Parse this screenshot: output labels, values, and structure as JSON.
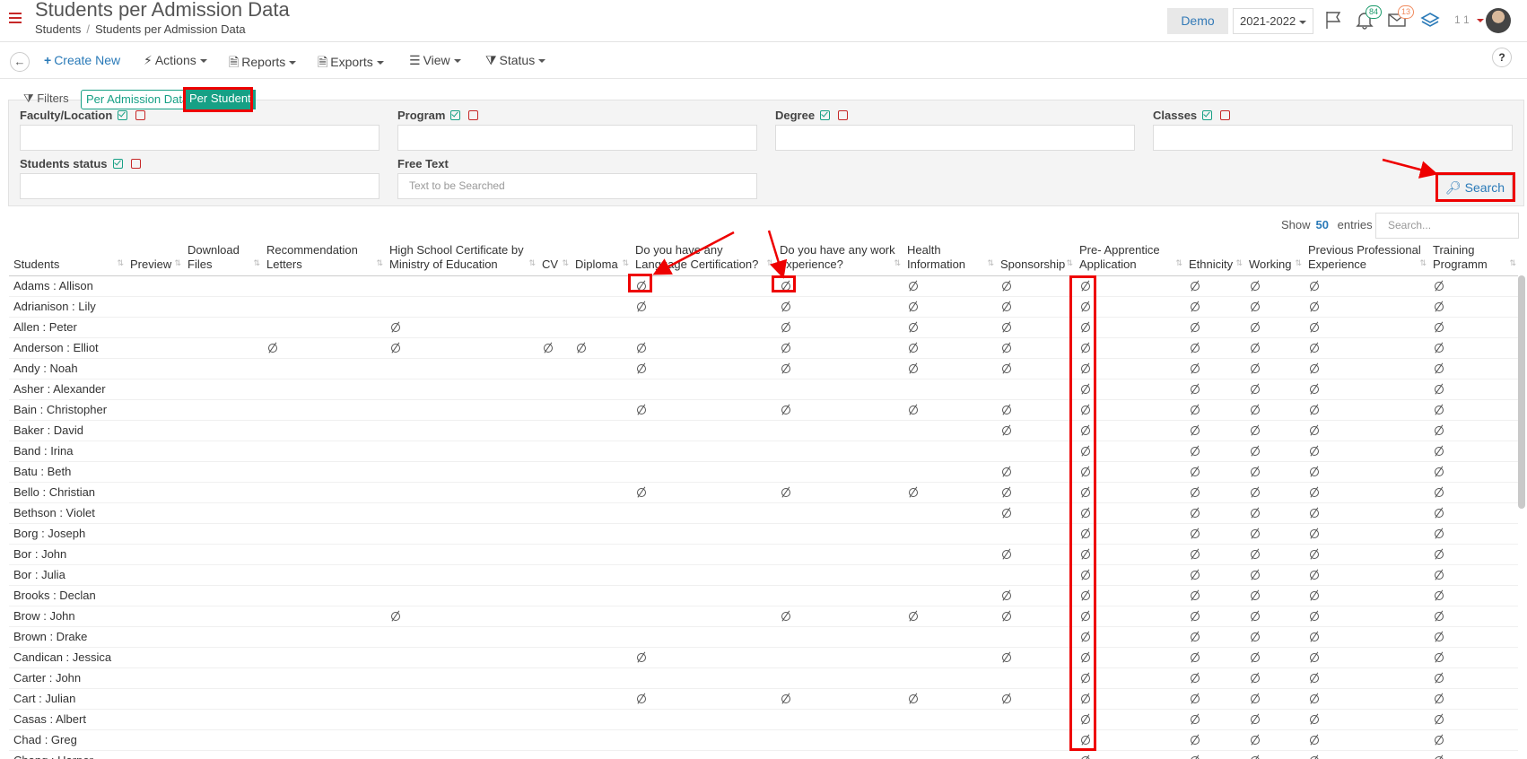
{
  "header": {
    "title": "Students per Admission Data",
    "breadcrumb": [
      "Students",
      "Students per Admission Data"
    ],
    "demo_label": "Demo",
    "year": "2021-2022",
    "notifications_count": "84",
    "messages_count": "13",
    "user_label": "1 1"
  },
  "toolbar": {
    "create": "Create New",
    "actions": "Actions",
    "reports": "Reports",
    "exports": "Exports",
    "view": "View",
    "status": "Status",
    "help": "?"
  },
  "filters": {
    "label": "Filters",
    "tab_admission": "Per Admission Data",
    "tab_student": "Per Student",
    "faculty": "Faculty/Location",
    "program": "Program",
    "degree": "Degree",
    "classes": "Classes",
    "students_status": "Students status",
    "free_text": "Free Text",
    "free_text_placeholder": "Text to be Searched",
    "search_button": "Search"
  },
  "table_controls": {
    "show": "Show",
    "count": "50",
    "entries": "entries",
    "search_placeholder": "Search..."
  },
  "columns": [
    "Students",
    "Preview",
    "Download Files",
    "Recommendation Letters",
    "High School Certificate by Ministry of Education",
    "CV",
    "Diploma",
    "Do you have any Language Certification?",
    "Do you have any work experience?",
    "Health Information",
    "Sponsorship",
    "Pre- Apprentice Application",
    "Ethnicity",
    "Working",
    "Previous Professional Experience",
    "Training Programm"
  ],
  "rows": [
    {
      "name": "Adams : Allison",
      "flags": [
        0,
        0,
        0,
        0,
        0,
        0,
        1,
        1,
        1,
        1,
        1,
        1,
        1,
        1,
        1
      ]
    },
    {
      "name": "Adrianison : Lily",
      "flags": [
        0,
        0,
        0,
        0,
        0,
        0,
        1,
        1,
        1,
        1,
        1,
        1,
        1,
        1,
        1
      ]
    },
    {
      "name": "Allen : Peter",
      "flags": [
        0,
        0,
        0,
        1,
        0,
        0,
        0,
        1,
        1,
        1,
        1,
        1,
        1,
        1,
        1
      ]
    },
    {
      "name": "Anderson : Elliot",
      "flags": [
        0,
        0,
        1,
        1,
        1,
        1,
        1,
        1,
        1,
        1,
        1,
        1,
        1,
        1,
        1
      ]
    },
    {
      "name": "Andy : Noah",
      "flags": [
        0,
        0,
        0,
        0,
        0,
        0,
        1,
        1,
        1,
        1,
        1,
        1,
        1,
        1,
        1
      ]
    },
    {
      "name": "Asher : Alexander",
      "flags": [
        0,
        0,
        0,
        0,
        0,
        0,
        0,
        0,
        0,
        0,
        1,
        1,
        1,
        1,
        1
      ]
    },
    {
      "name": "Bain : Christopher",
      "flags": [
        0,
        0,
        0,
        0,
        0,
        0,
        1,
        1,
        1,
        1,
        1,
        1,
        1,
        1,
        1
      ]
    },
    {
      "name": "Baker : David",
      "flags": [
        0,
        0,
        0,
        0,
        0,
        0,
        0,
        0,
        0,
        1,
        1,
        1,
        1,
        1,
        1
      ]
    },
    {
      "name": "Band : Irina",
      "flags": [
        0,
        0,
        0,
        0,
        0,
        0,
        0,
        0,
        0,
        0,
        1,
        1,
        1,
        1,
        1
      ]
    },
    {
      "name": "Batu : Beth",
      "flags": [
        0,
        0,
        0,
        0,
        0,
        0,
        0,
        0,
        0,
        1,
        1,
        1,
        1,
        1,
        1
      ]
    },
    {
      "name": "Bello : Christian",
      "flags": [
        0,
        0,
        0,
        0,
        0,
        0,
        1,
        1,
        1,
        1,
        1,
        1,
        1,
        1,
        1
      ]
    },
    {
      "name": "Bethson : Violet",
      "flags": [
        0,
        0,
        0,
        0,
        0,
        0,
        0,
        0,
        0,
        1,
        1,
        1,
        1,
        1,
        1
      ]
    },
    {
      "name": "Borg : Joseph",
      "flags": [
        0,
        0,
        0,
        0,
        0,
        0,
        0,
        0,
        0,
        0,
        1,
        1,
        1,
        1,
        1
      ]
    },
    {
      "name": "Bor : John",
      "flags": [
        0,
        0,
        0,
        0,
        0,
        0,
        0,
        0,
        0,
        1,
        1,
        1,
        1,
        1,
        1
      ]
    },
    {
      "name": "Bor : Julia",
      "flags": [
        0,
        0,
        0,
        0,
        0,
        0,
        0,
        0,
        0,
        0,
        1,
        1,
        1,
        1,
        1
      ]
    },
    {
      "name": "Brooks : Declan",
      "flags": [
        0,
        0,
        0,
        0,
        0,
        0,
        0,
        0,
        0,
        1,
        1,
        1,
        1,
        1,
        1
      ]
    },
    {
      "name": "Brow : John",
      "flags": [
        0,
        0,
        0,
        1,
        0,
        0,
        0,
        1,
        1,
        1,
        1,
        1,
        1,
        1,
        1
      ]
    },
    {
      "name": "Brown : Drake",
      "flags": [
        0,
        0,
        0,
        0,
        0,
        0,
        0,
        0,
        0,
        0,
        1,
        1,
        1,
        1,
        1
      ]
    },
    {
      "name": "Candican : Jessica",
      "flags": [
        0,
        0,
        0,
        0,
        0,
        0,
        1,
        0,
        0,
        1,
        1,
        1,
        1,
        1,
        1
      ]
    },
    {
      "name": "Carter : John",
      "flags": [
        0,
        0,
        0,
        0,
        0,
        0,
        0,
        0,
        0,
        0,
        1,
        1,
        1,
        1,
        1
      ]
    },
    {
      "name": "Cart : Julian",
      "flags": [
        0,
        0,
        0,
        0,
        0,
        0,
        1,
        1,
        1,
        1,
        1,
        1,
        1,
        1,
        1
      ]
    },
    {
      "name": "Casas : Albert",
      "flags": [
        0,
        0,
        0,
        0,
        0,
        0,
        0,
        0,
        0,
        0,
        1,
        1,
        1,
        1,
        1
      ]
    },
    {
      "name": "Chad : Greg",
      "flags": [
        0,
        0,
        0,
        0,
        0,
        0,
        0,
        0,
        0,
        0,
        1,
        1,
        1,
        1,
        1
      ]
    },
    {
      "name": "Chang : Harper",
      "flags": [
        0,
        0,
        0,
        0,
        0,
        0,
        0,
        0,
        0,
        0,
        1,
        1,
        1,
        1,
        1
      ]
    }
  ],
  "icons": {
    "menu": "hamburger-icon",
    "flag": "flag-icon",
    "bell": "bell-icon",
    "mail": "mail-icon",
    "layers": "layers-icon",
    "empty": "empty-set-icon"
  },
  "colors": {
    "accent": "#16a085",
    "link": "#2a7ab8",
    "highlight": "#e00000"
  }
}
